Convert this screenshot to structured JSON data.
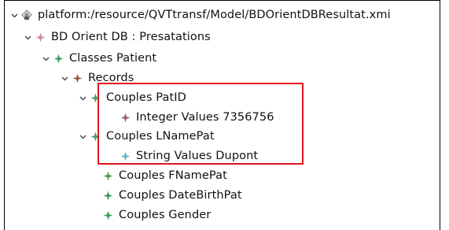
{
  "tree": {
    "root": {
      "label": "platform:/resource/QVTtransf/Model/BDOrientDBResultat.xmi",
      "icon": "resource-file-icon",
      "expanded": true
    },
    "bd_orient": {
      "label": "BD Orient DB : Presatations",
      "icon": "model-element-icon",
      "expanded": true
    },
    "classes_patient": {
      "label": "Classes Patient",
      "icon": "model-element-icon",
      "expanded": true
    },
    "records": {
      "label": "Records",
      "icon": "model-element-icon",
      "expanded": true
    },
    "couples_patid": {
      "label": "Couples PatID",
      "icon": "model-element-icon",
      "expanded": true
    },
    "integer_values": {
      "label": "Integer Values 7356756",
      "icon": "model-element-icon"
    },
    "couples_lnamepat": {
      "label": "Couples LNamePat",
      "icon": "model-element-icon",
      "expanded": true
    },
    "string_values": {
      "label": "String Values Dupont",
      "icon": "model-element-icon"
    },
    "couples_fnamepat": {
      "label": "Couples FNamePat",
      "icon": "model-element-icon"
    },
    "couples_datebirthpat": {
      "label": "Couples DateBirthPat",
      "icon": "model-element-icon"
    },
    "couples_gender": {
      "label": "Couples Gender",
      "icon": "model-element-icon"
    }
  },
  "colors": {
    "highlight_border": "#e0141e",
    "icon_pink": "#c9879e",
    "icon_green": "#3f9a5a",
    "icon_brown": "#9a5a3c",
    "icon_light_blue": "#5bb7c9",
    "chevron": "#444444"
  }
}
